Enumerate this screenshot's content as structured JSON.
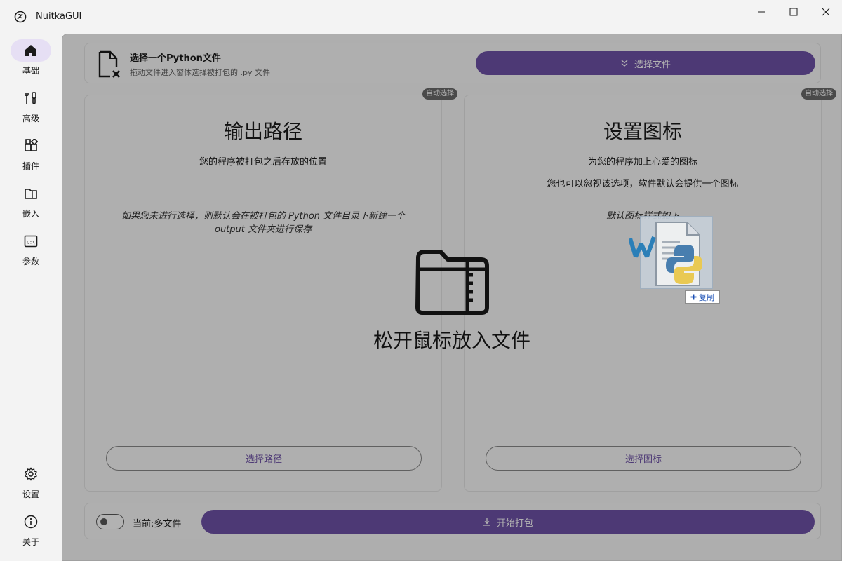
{
  "app": {
    "title": "NuitkaGUI"
  },
  "nav": {
    "items": [
      {
        "label": "基础",
        "icon": "home-icon",
        "active": true
      },
      {
        "label": "高级",
        "icon": "tools-icon",
        "active": false
      },
      {
        "label": "插件",
        "icon": "puzzle-icon",
        "active": false
      },
      {
        "label": "嵌入",
        "icon": "folder-embed-icon",
        "active": false
      },
      {
        "label": "参数",
        "icon": "terminal-icon",
        "active": false
      }
    ],
    "bottom": [
      {
        "label": "设置",
        "icon": "gear-icon"
      },
      {
        "label": "关于",
        "icon": "info-icon"
      }
    ]
  },
  "file_select": {
    "title": "选择一个Python文件",
    "subtitle": "拖动文件进入窗体选择被打包的 .py 文件",
    "button": "选择文件"
  },
  "output_panel": {
    "badge": "自动选择",
    "title": "输出路径",
    "desc": "您的程序被打包之后存放的位置",
    "note_line1": "如果您未进行选择，则默认会在被打包的 Python 文件目录下新建一个",
    "note_line2": "output 文件夹进行保存",
    "button": "选择路径"
  },
  "icon_panel": {
    "badge": "自动选择",
    "title": "设置图标",
    "desc1": "为您的程序加上心爱的图标",
    "desc2": "您也可以忽视该选项，软件默认会提供一个图标",
    "note": "默认图标样式如下",
    "button": "选择图标"
  },
  "bottom_bar": {
    "mode_label": "当前:多文件",
    "start_button": "开始打包"
  },
  "drop_overlay": {
    "text": "松开鼠标放入文件"
  },
  "drag_ghost": {
    "copy_label": "复制"
  },
  "colors": {
    "accent": "#6f52a8",
    "nav_active_bg": "#e6dff4"
  }
}
